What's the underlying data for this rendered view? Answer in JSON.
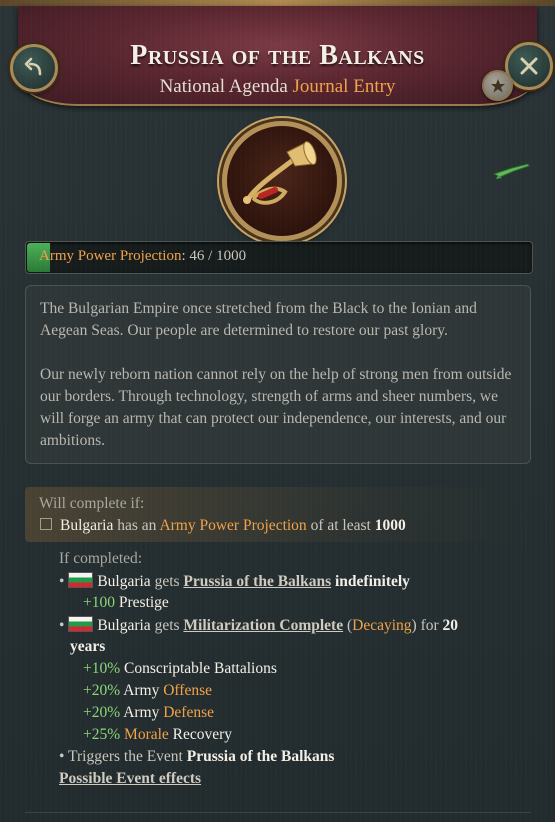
{
  "header": {
    "title": "Prussia of the Balkans",
    "subtitle_plain": "National Agenda",
    "subtitle_accent": "Journal Entry",
    "back_icon": "back-arrow-icon",
    "close_icon": "close-x-icon",
    "star_icon": "star-icon"
  },
  "medallion": {
    "icon": "bugle-icon"
  },
  "rifle": {
    "icon": "rifle-icon"
  },
  "progress": {
    "label": "Army Power Projection",
    "value_text": ": 46 / 1000",
    "current": 46,
    "max": 1000
  },
  "description": {
    "paragraph1": "The Bulgarian Empire once stretched from the Black to the Ionian and Aegean Seas. Our people are determined to restore our past glory.",
    "paragraph2": "Our newly reborn nation cannot rely on the help of strong men from outside our borders. Through technology, strength of arms and sheer numbers, we will forge an army that can protect our independence, our interests, and our ambitions."
  },
  "requirements": {
    "label": "Will complete if:",
    "country": "Bulgaria",
    "has_an": "has an",
    "metric": "Army Power Projection",
    "of_at_least": "of at least",
    "target": "1000"
  },
  "effects": {
    "label": "If completed:",
    "bullet": "•",
    "item1": {
      "country": "Bulgaria",
      "gets": "gets",
      "modifier": "Prussia of the Balkans",
      "duration": "indefinitely",
      "sub1_value": "+100",
      "sub1_label": "Prestige"
    },
    "item2": {
      "country": "Bulgaria",
      "gets": "gets",
      "modifier": "Militarization Complete",
      "paren_open": "(",
      "decaying": "Decaying",
      "paren_close": ")",
      "for": "for",
      "years_num": "20",
      "years_word": "years",
      "sub1_value": "+10%",
      "sub1_label": "Conscriptable Battalions",
      "sub2_value": "+20%",
      "sub2_army": "Army",
      "sub2_label": "Offense",
      "sub3_value": "+20%",
      "sub3_army": "Army",
      "sub3_label": "Defense",
      "sub4_value": "+25%",
      "sub4_label": "Morale",
      "sub4_rest": "Recovery"
    },
    "item3": {
      "prefix": "Triggers the Event",
      "event": "Prussia of the Balkans",
      "link": "Possible Event effects"
    }
  },
  "colors": {
    "accent_orange": "#f0a24a",
    "positive_green": "#8cd67a",
    "header_red": "#5a2630",
    "gold_trim": "#b39058"
  }
}
